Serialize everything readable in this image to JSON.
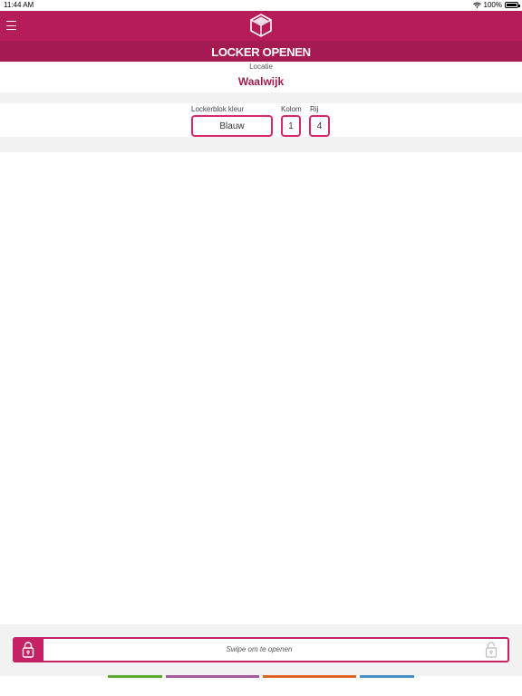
{
  "status_bar": {
    "time": "11:44 AM",
    "battery": "100%"
  },
  "header": {
    "title": "LOCKER OPENEN",
    "menu_icon": "hamburger-icon",
    "logo_icon": "cube-logo-icon"
  },
  "location": {
    "label": "Locatie",
    "value": "Waalwijk"
  },
  "fields": {
    "color_label": "Lockerblok kleur",
    "color_value": "Blauw",
    "column_label": "Kolom",
    "column_value": "1",
    "row_label": "Rij",
    "row_value": "4"
  },
  "swipe": {
    "text": "Swipe om te openen",
    "handle_icon": "lock-icon",
    "end_icon": "lock-outline-icon"
  },
  "colors": {
    "primary": "#b51c58",
    "accent": "#d8266f",
    "bars": [
      "#5aab32",
      "#a65aa0",
      "#e06428",
      "#4a90c8"
    ]
  }
}
